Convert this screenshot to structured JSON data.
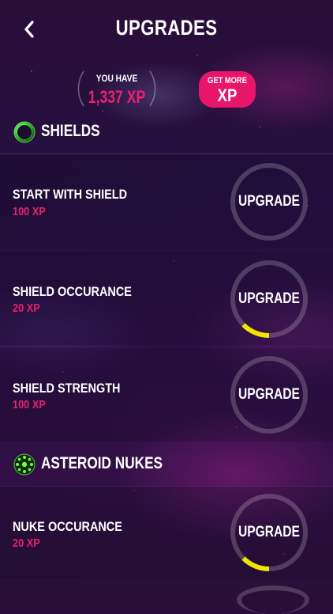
{
  "header": {
    "title": "UPGRADES",
    "back_icon": "back-chevron-icon"
  },
  "xp": {
    "you_have_label": "YOU HAVE",
    "amount": "1,337 XP",
    "get_more_label": "GET MORE",
    "get_more_xp": "XP"
  },
  "colors": {
    "accent_pink": "#e8166b",
    "progress_yellow": "#f2e600",
    "shield_icon_green": "#3fcf3a"
  },
  "sections": [
    {
      "title": "SHIELDS",
      "icon": "shield-orb-icon",
      "items": [
        {
          "name": "START WITH SHIELD",
          "cost": "100 XP",
          "button": "UPGRADE",
          "progress": 0
        },
        {
          "name": "SHIELD OCCURANCE",
          "cost": "20 XP",
          "button": "UPGRADE",
          "progress": 0.125
        },
        {
          "name": "SHIELD STRENGTH",
          "cost": "100 XP",
          "button": "UPGRADE",
          "progress": 0
        }
      ]
    },
    {
      "title": "ASTEROID NUKES",
      "icon": "nuke-burst-icon",
      "items": [
        {
          "name": "NUKE OCCURANCE",
          "cost": "20 XP",
          "button": "UPGRADE",
          "progress": 0.125
        }
      ]
    }
  ]
}
